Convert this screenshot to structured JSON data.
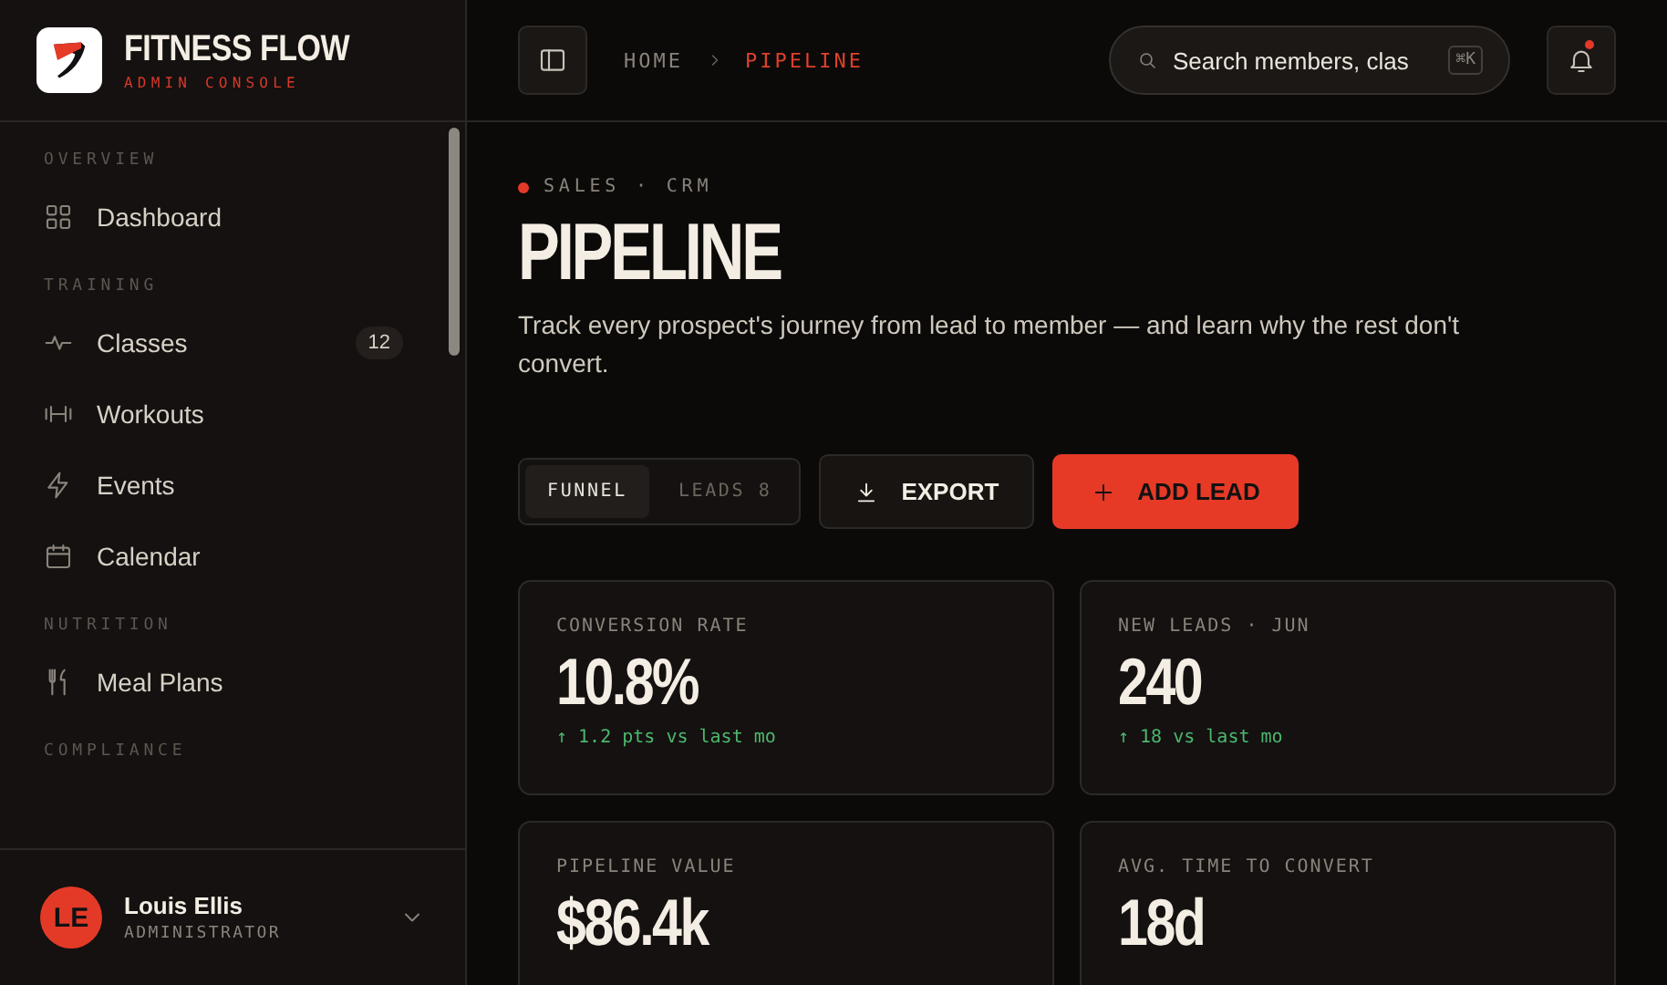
{
  "brand": {
    "name": "FITNESS FLOW",
    "subtitle": "ADMIN CONSOLE"
  },
  "sidebar": {
    "sections": [
      {
        "label": "OVERVIEW",
        "items": [
          {
            "label": "Dashboard",
            "selected": false
          }
        ]
      },
      {
        "label": "TRAINING",
        "items": [
          {
            "label": "Classes",
            "badge": "12",
            "selected": false
          },
          {
            "label": "Workouts",
            "selected": false
          },
          {
            "label": "Events",
            "selected": false
          },
          {
            "label": "Calendar",
            "selected": false
          }
        ]
      },
      {
        "label": "NUTRITION",
        "items": [
          {
            "label": "Meal Plans",
            "selected": false
          }
        ]
      },
      {
        "label": "COMPLIANCE"
      }
    ]
  },
  "user": {
    "initials": "LE",
    "name": "Louis Ellis",
    "role": "ADMINISTRATOR"
  },
  "breadcrumb": [
    {
      "label": "HOME",
      "current": false
    },
    {
      "label": "PIPELINE",
      "current": true
    }
  ],
  "search": {
    "placeholder": "Search members, clas",
    "shortcut": "⌘K"
  },
  "notifications": {
    "unread": true
  },
  "page": {
    "eyebrow": "SALES · CRM",
    "title": "PIPELINE",
    "description": "Track every prospect's journey from lead to member — and learn why the rest don't convert."
  },
  "tabs": [
    {
      "label": "FUNNEL",
      "selected": true
    },
    {
      "label": "LEADS",
      "count": "8",
      "selected": false
    }
  ],
  "actions": [
    {
      "label": "EXPORT",
      "kind": "secondary"
    },
    {
      "label": "ADD LEAD",
      "kind": "primary"
    }
  ],
  "stats": [
    {
      "label": "CONVERSION RATE",
      "value": "10.8%",
      "delta": "↑ 1.2 pts vs last mo"
    },
    {
      "label": "NEW LEADS · JUN",
      "value": "240",
      "delta": "↑ 18 vs last mo"
    },
    {
      "label": "PIPELINE VALUE",
      "value": "$86.4k"
    },
    {
      "label": "AVG. TIME TO CONVERT",
      "value": "18d"
    }
  ]
}
